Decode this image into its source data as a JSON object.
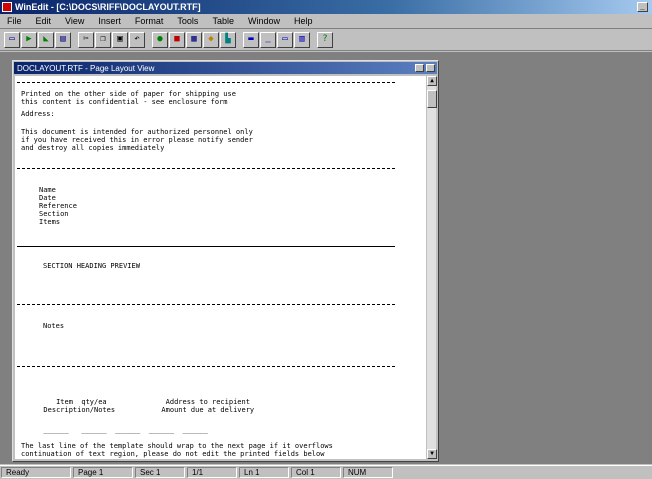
{
  "window": {
    "title": "WinEdit - [C:\\DOCS\\RIFF\\DOCLAYOUT.RTF]",
    "close": "✕",
    "minimize": "_"
  },
  "menu": [
    "File",
    "Edit",
    "View",
    "Insert",
    "Format",
    "Tools",
    "Table",
    "Window",
    "Help"
  ],
  "toolbar": [
    "new-icon",
    "open-icon",
    "save-icon",
    "print-icon",
    "sep",
    "cut-icon",
    "copy-icon",
    "paste-icon",
    "undo-icon",
    "sep",
    "bold-icon",
    "italic-icon",
    "underline-icon",
    "color-icon",
    "image-icon",
    "sep",
    "table-icon",
    "columns-icon",
    "frame-icon",
    "zoom-icon",
    "sep",
    "help-icon"
  ],
  "document": {
    "title": "DOCLAYOUT.RTF - Page Layout View",
    "lines": [
      "Printed on the other side of paper for shipping use",
      "this content is confidential - see enclosure form",
      "Address:",
      "",
      "This document is intended for authorized personnel only",
      "if you have received this in error please notify sender",
      "and destroy all copies immediately",
      "",
      "Name",
      "Date",
      "Reference",
      "Section",
      "Items",
      "",
      "SECTION HEADING PREVIEW",
      "",
      "Notes",
      "",
      "     Item  qty/ea              Address to recipient",
      "  Description/Notes           Amount due at delivery",
      "  ______   ______  ______  ______  ______",
      "The last line of the template should wrap to the next page if it overflows",
      "continuation of text region, please do not edit the printed fields below"
    ]
  },
  "status": [
    "Ready",
    "Page 1",
    "Sec 1",
    "1/1",
    "Ln 1",
    "Col 1",
    "NUM"
  ]
}
